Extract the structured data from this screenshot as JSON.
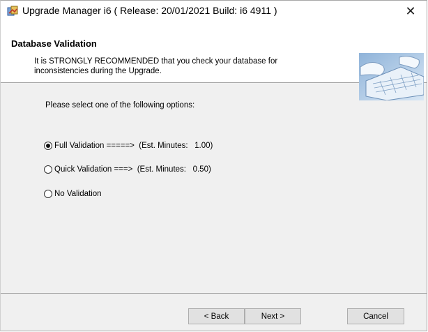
{
  "window": {
    "title": "Upgrade Manager i6 ( Release: 20/01/2021   Build: i6 4911 )",
    "close_label": "✕",
    "app_icon": "installer-icon"
  },
  "header": {
    "title": "Database Validation",
    "subtitle": "It is STRONGLY RECOMMENDED that you check your database for inconsistencies during the Upgrade.",
    "image": "keyboard-typing-image"
  },
  "main": {
    "prompt": "Please select one of the following options:",
    "options": [
      {
        "label": "Full Validation =====>  (Est. Minutes:   1.00)",
        "checked": true
      },
      {
        "label": "Quick Validation ===>  (Est. Minutes:   0.50)",
        "checked": false
      },
      {
        "label": "No Validation",
        "checked": false
      }
    ]
  },
  "buttons": {
    "back": "< Back",
    "next": "Next >",
    "cancel": "Cancel"
  }
}
